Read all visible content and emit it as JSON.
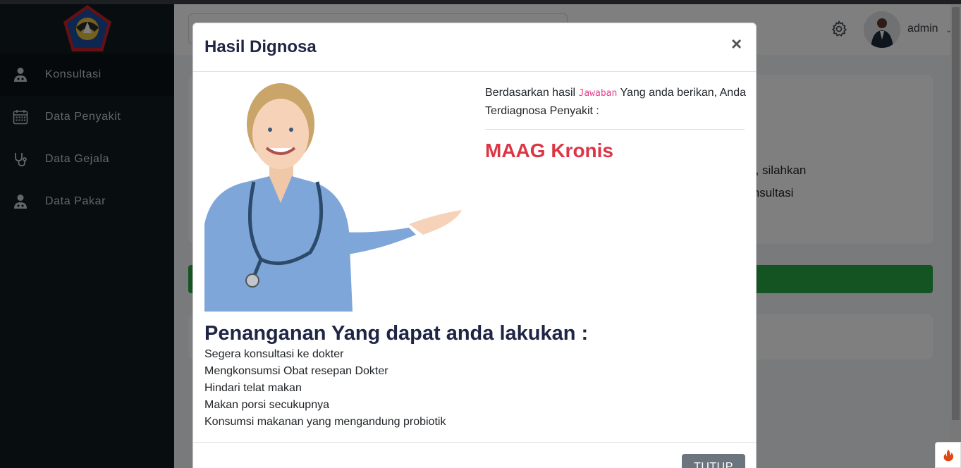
{
  "sidebar": {
    "items": [
      {
        "label": "Konsultasi",
        "icon": "user-doctor-icon"
      },
      {
        "label": "Data Penyakit",
        "icon": "calendar-icon"
      },
      {
        "label": "Data Gejala",
        "icon": "stethoscope-icon"
      },
      {
        "label": "Data Pakar",
        "icon": "user-doctor-icon"
      }
    ]
  },
  "header": {
    "username": "admin"
  },
  "page": {
    "text_line1": "rah, silahkan",
    "text_line2": "Konsultasi"
  },
  "modal": {
    "title": "Hasil Dignosa",
    "close_symbol": "×",
    "intro_before": "Berdasarkan hasil ",
    "intro_code": "Jawaban",
    "intro_after": " Yang anda berikan, Anda Terdiagnosa Penyakit :",
    "disease": "MAAG Kronis",
    "heading": "Penanganan Yang dapat anda lakukan :",
    "treatments": [
      "Segera konsultasi ke dokter",
      "Mengkonsumsi Obat resepan Dokter",
      "Hindari telat makan",
      "Makan porsi secukupnya",
      "Konsumsi makanan yang mengandung probiotik"
    ],
    "close_button": "TUTUP"
  },
  "colors": {
    "sidebar_bg": "#101b1f",
    "disease_red": "#dc3545",
    "title_navy": "#1f2544",
    "green": "#28a745",
    "button_gray": "#6c757d"
  }
}
